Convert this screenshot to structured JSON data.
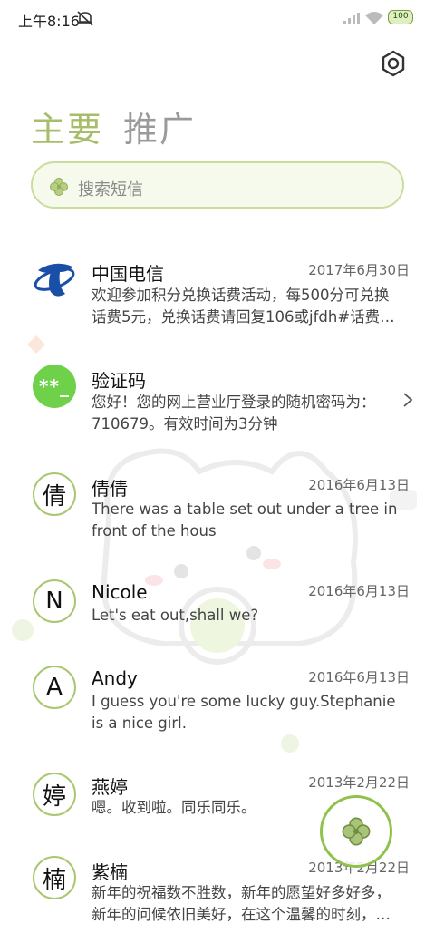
{
  "status_bar": {
    "time": "上午8:16",
    "battery": "100",
    "icons": [
      "mute-icon",
      "signal-icon",
      "wifi-icon",
      "battery-icon"
    ]
  },
  "header": {
    "settings_icon": "gear-icon"
  },
  "tabs": [
    {
      "label": "主要",
      "active": true
    },
    {
      "label": "推广",
      "active": false
    }
  ],
  "search": {
    "placeholder": "搜索短信",
    "icon": "clover-icon"
  },
  "colors": {
    "accent": "#a8bd6a",
    "avatar_border": "#a8c76e",
    "code_avatar": "#6fd14a",
    "telecom_blue": "#1a4fa8"
  },
  "conversations": [
    {
      "avatar": "china-telecom-logo",
      "name": "中国电信",
      "date": "2017年6月30日",
      "preview_lines": [
        "欢迎参加积分兑换话费活动，每500分可兑换",
        "话费5元，兑换话费请回复106或jfdh#话费…"
      ]
    },
    {
      "avatar": "**_",
      "name": "验证码",
      "date": "",
      "preview_lines": [
        "您好！您的网上营业厅登录的随机密码为：",
        "710679。有效时间为3分钟"
      ]
    },
    {
      "avatar": "倩",
      "name": "倩倩",
      "date": "2016年6月13日",
      "preview_lines": [
        "There was a table set out under a tree in",
        "front of the hous"
      ]
    },
    {
      "avatar": "N",
      "name": "Nicole",
      "date": "2016年6月13日",
      "preview_lines": [
        "Let's eat out,shall we?"
      ]
    },
    {
      "avatar": "A",
      "name": "Andy",
      "date": "2016年6月13日",
      "preview_lines": [
        "I guess you're some lucky guy.Stephanie",
        "is a nice girl."
      ]
    },
    {
      "avatar": "婷",
      "name": "燕婷",
      "date": "2013年2月22日",
      "preview_lines": [
        "嗯。收到啦。同乐同乐。"
      ]
    },
    {
      "avatar": "楠",
      "name": "紫楠",
      "date": "2013年2月22日",
      "preview_lines": [
        "新年的祝福数不胜数，新年的愿望好多好多，",
        "新年的问候依旧美好，在这个温馨的时刻，…"
      ]
    }
  ],
  "fab": {
    "icon": "clover-icon"
  }
}
